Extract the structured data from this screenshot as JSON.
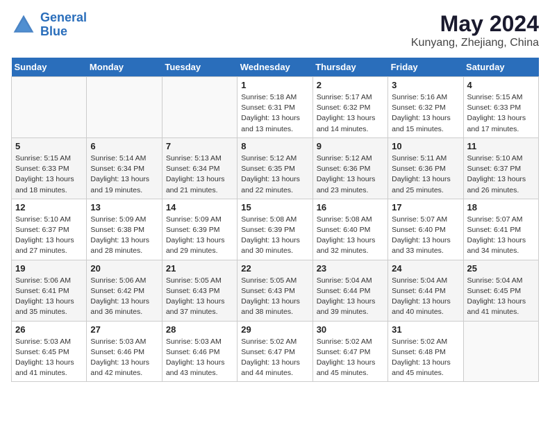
{
  "header": {
    "logo_line1": "General",
    "logo_line2": "Blue",
    "main_title": "May 2024",
    "subtitle": "Kunyang, Zhejiang, China"
  },
  "days_of_week": [
    "Sunday",
    "Monday",
    "Tuesday",
    "Wednesday",
    "Thursday",
    "Friday",
    "Saturday"
  ],
  "weeks": [
    [
      {
        "day": "",
        "details": ""
      },
      {
        "day": "",
        "details": ""
      },
      {
        "day": "",
        "details": ""
      },
      {
        "day": "1",
        "details": "Sunrise: 5:18 AM\nSunset: 6:31 PM\nDaylight: 13 hours\nand 13 minutes."
      },
      {
        "day": "2",
        "details": "Sunrise: 5:17 AM\nSunset: 6:32 PM\nDaylight: 13 hours\nand 14 minutes."
      },
      {
        "day": "3",
        "details": "Sunrise: 5:16 AM\nSunset: 6:32 PM\nDaylight: 13 hours\nand 15 minutes."
      },
      {
        "day": "4",
        "details": "Sunrise: 5:15 AM\nSunset: 6:33 PM\nDaylight: 13 hours\nand 17 minutes."
      }
    ],
    [
      {
        "day": "5",
        "details": "Sunrise: 5:15 AM\nSunset: 6:33 PM\nDaylight: 13 hours\nand 18 minutes."
      },
      {
        "day": "6",
        "details": "Sunrise: 5:14 AM\nSunset: 6:34 PM\nDaylight: 13 hours\nand 19 minutes."
      },
      {
        "day": "7",
        "details": "Sunrise: 5:13 AM\nSunset: 6:34 PM\nDaylight: 13 hours\nand 21 minutes."
      },
      {
        "day": "8",
        "details": "Sunrise: 5:12 AM\nSunset: 6:35 PM\nDaylight: 13 hours\nand 22 minutes."
      },
      {
        "day": "9",
        "details": "Sunrise: 5:12 AM\nSunset: 6:36 PM\nDaylight: 13 hours\nand 23 minutes."
      },
      {
        "day": "10",
        "details": "Sunrise: 5:11 AM\nSunset: 6:36 PM\nDaylight: 13 hours\nand 25 minutes."
      },
      {
        "day": "11",
        "details": "Sunrise: 5:10 AM\nSunset: 6:37 PM\nDaylight: 13 hours\nand 26 minutes."
      }
    ],
    [
      {
        "day": "12",
        "details": "Sunrise: 5:10 AM\nSunset: 6:37 PM\nDaylight: 13 hours\nand 27 minutes."
      },
      {
        "day": "13",
        "details": "Sunrise: 5:09 AM\nSunset: 6:38 PM\nDaylight: 13 hours\nand 28 minutes."
      },
      {
        "day": "14",
        "details": "Sunrise: 5:09 AM\nSunset: 6:39 PM\nDaylight: 13 hours\nand 29 minutes."
      },
      {
        "day": "15",
        "details": "Sunrise: 5:08 AM\nSunset: 6:39 PM\nDaylight: 13 hours\nand 30 minutes."
      },
      {
        "day": "16",
        "details": "Sunrise: 5:08 AM\nSunset: 6:40 PM\nDaylight: 13 hours\nand 32 minutes."
      },
      {
        "day": "17",
        "details": "Sunrise: 5:07 AM\nSunset: 6:40 PM\nDaylight: 13 hours\nand 33 minutes."
      },
      {
        "day": "18",
        "details": "Sunrise: 5:07 AM\nSunset: 6:41 PM\nDaylight: 13 hours\nand 34 minutes."
      }
    ],
    [
      {
        "day": "19",
        "details": "Sunrise: 5:06 AM\nSunset: 6:41 PM\nDaylight: 13 hours\nand 35 minutes."
      },
      {
        "day": "20",
        "details": "Sunrise: 5:06 AM\nSunset: 6:42 PM\nDaylight: 13 hours\nand 36 minutes."
      },
      {
        "day": "21",
        "details": "Sunrise: 5:05 AM\nSunset: 6:43 PM\nDaylight: 13 hours\nand 37 minutes."
      },
      {
        "day": "22",
        "details": "Sunrise: 5:05 AM\nSunset: 6:43 PM\nDaylight: 13 hours\nand 38 minutes."
      },
      {
        "day": "23",
        "details": "Sunrise: 5:04 AM\nSunset: 6:44 PM\nDaylight: 13 hours\nand 39 minutes."
      },
      {
        "day": "24",
        "details": "Sunrise: 5:04 AM\nSunset: 6:44 PM\nDaylight: 13 hours\nand 40 minutes."
      },
      {
        "day": "25",
        "details": "Sunrise: 5:04 AM\nSunset: 6:45 PM\nDaylight: 13 hours\nand 41 minutes."
      }
    ],
    [
      {
        "day": "26",
        "details": "Sunrise: 5:03 AM\nSunset: 6:45 PM\nDaylight: 13 hours\nand 41 minutes."
      },
      {
        "day": "27",
        "details": "Sunrise: 5:03 AM\nSunset: 6:46 PM\nDaylight: 13 hours\nand 42 minutes."
      },
      {
        "day": "28",
        "details": "Sunrise: 5:03 AM\nSunset: 6:46 PM\nDaylight: 13 hours\nand 43 minutes."
      },
      {
        "day": "29",
        "details": "Sunrise: 5:02 AM\nSunset: 6:47 PM\nDaylight: 13 hours\nand 44 minutes."
      },
      {
        "day": "30",
        "details": "Sunrise: 5:02 AM\nSunset: 6:47 PM\nDaylight: 13 hours\nand 45 minutes."
      },
      {
        "day": "31",
        "details": "Sunrise: 5:02 AM\nSunset: 6:48 PM\nDaylight: 13 hours\nand 45 minutes."
      },
      {
        "day": "",
        "details": ""
      }
    ]
  ]
}
